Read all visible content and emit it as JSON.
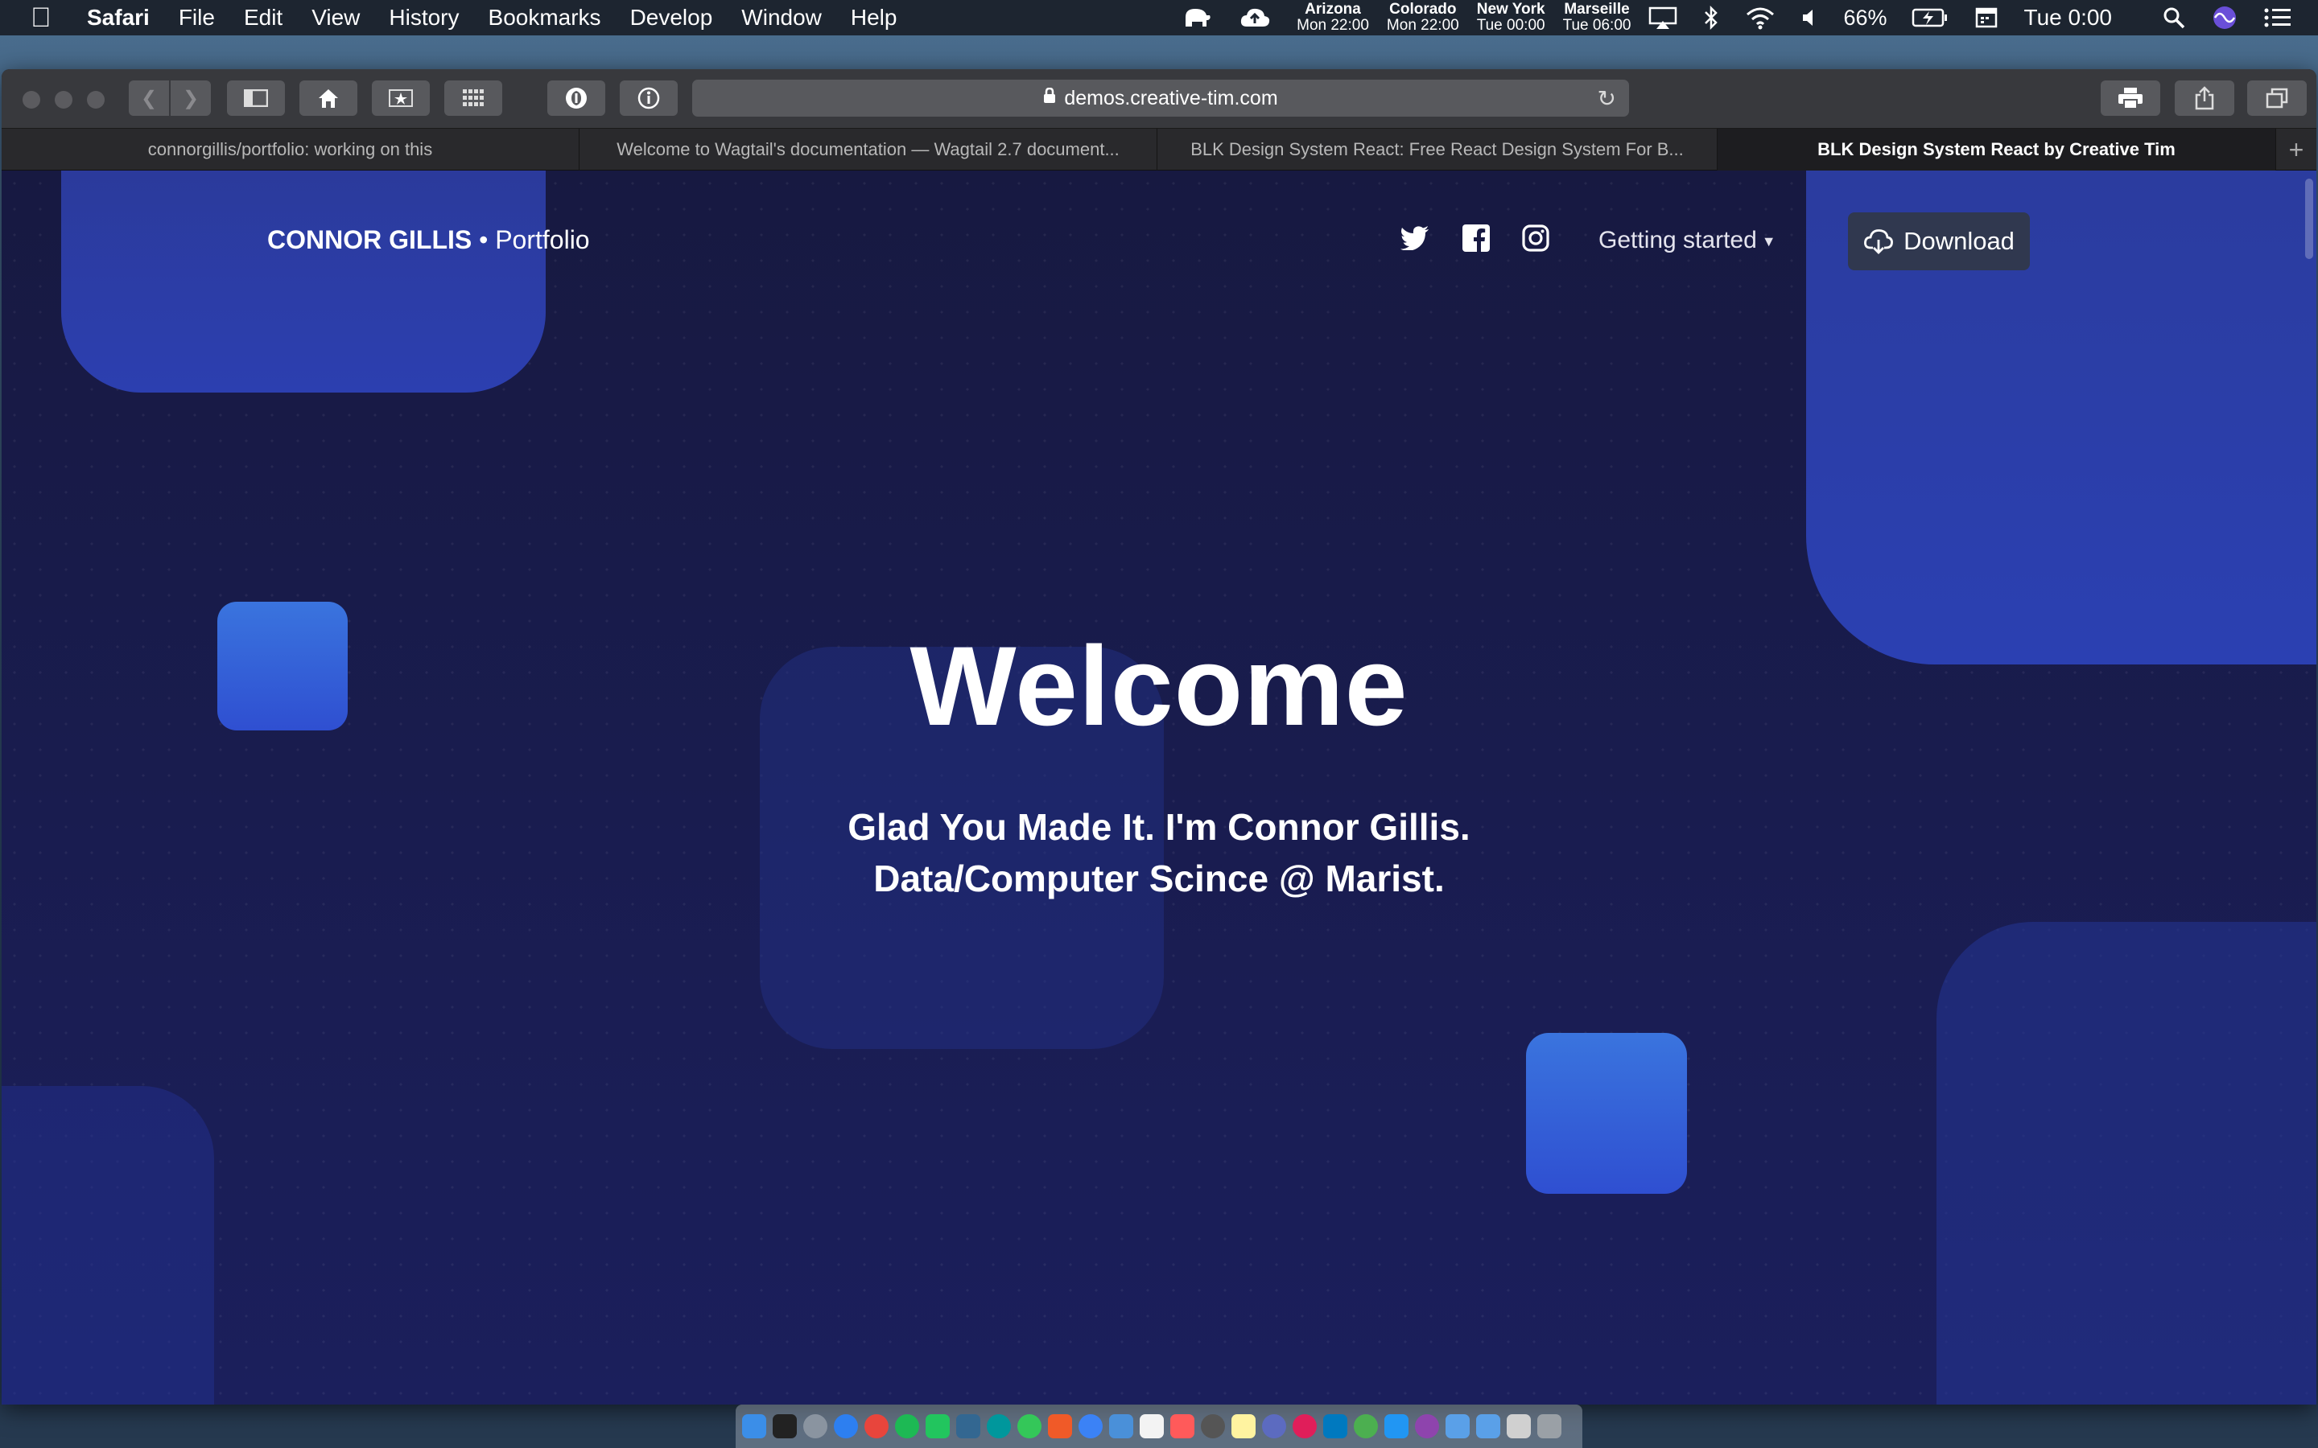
{
  "menubar": {
    "app": "Safari",
    "items": [
      "File",
      "Edit",
      "View",
      "History",
      "Bookmarks",
      "Develop",
      "Window",
      "Help"
    ],
    "clocks": [
      {
        "city": "Arizona",
        "time": "Mon 22:00"
      },
      {
        "city": "Colorado",
        "time": "Mon 22:00"
      },
      {
        "city": "New York",
        "time": "Tue 00:00"
      },
      {
        "city": "Marseille",
        "time": "Tue 06:00"
      }
    ],
    "battery": "66%",
    "time": "Tue 0:00"
  },
  "browser": {
    "url": "demos.creative-tim.com",
    "tabs": [
      "connorgillis/portfolio: working on this",
      "Welcome to Wagtail's documentation — Wagtail 2.7 document...",
      "BLK Design System React: Free React Design System For B...",
      "BLK Design System React by Creative Tim"
    ],
    "active_tab": 3
  },
  "site": {
    "brand_bold": "CONNOR GILLIS",
    "brand_rest": "• Portfolio",
    "nav_getting_started": "Getting started",
    "download_label": "Download",
    "hero_title": "Welcome",
    "hero_line1": "Glad You Made It. I'm Connor Gillis.",
    "hero_line2": "Data/Computer Scince @ Marist."
  },
  "colors": {
    "page_bg": "#171941",
    "accent_blue": "#3358f4",
    "square_blue": "#3a78e0"
  }
}
